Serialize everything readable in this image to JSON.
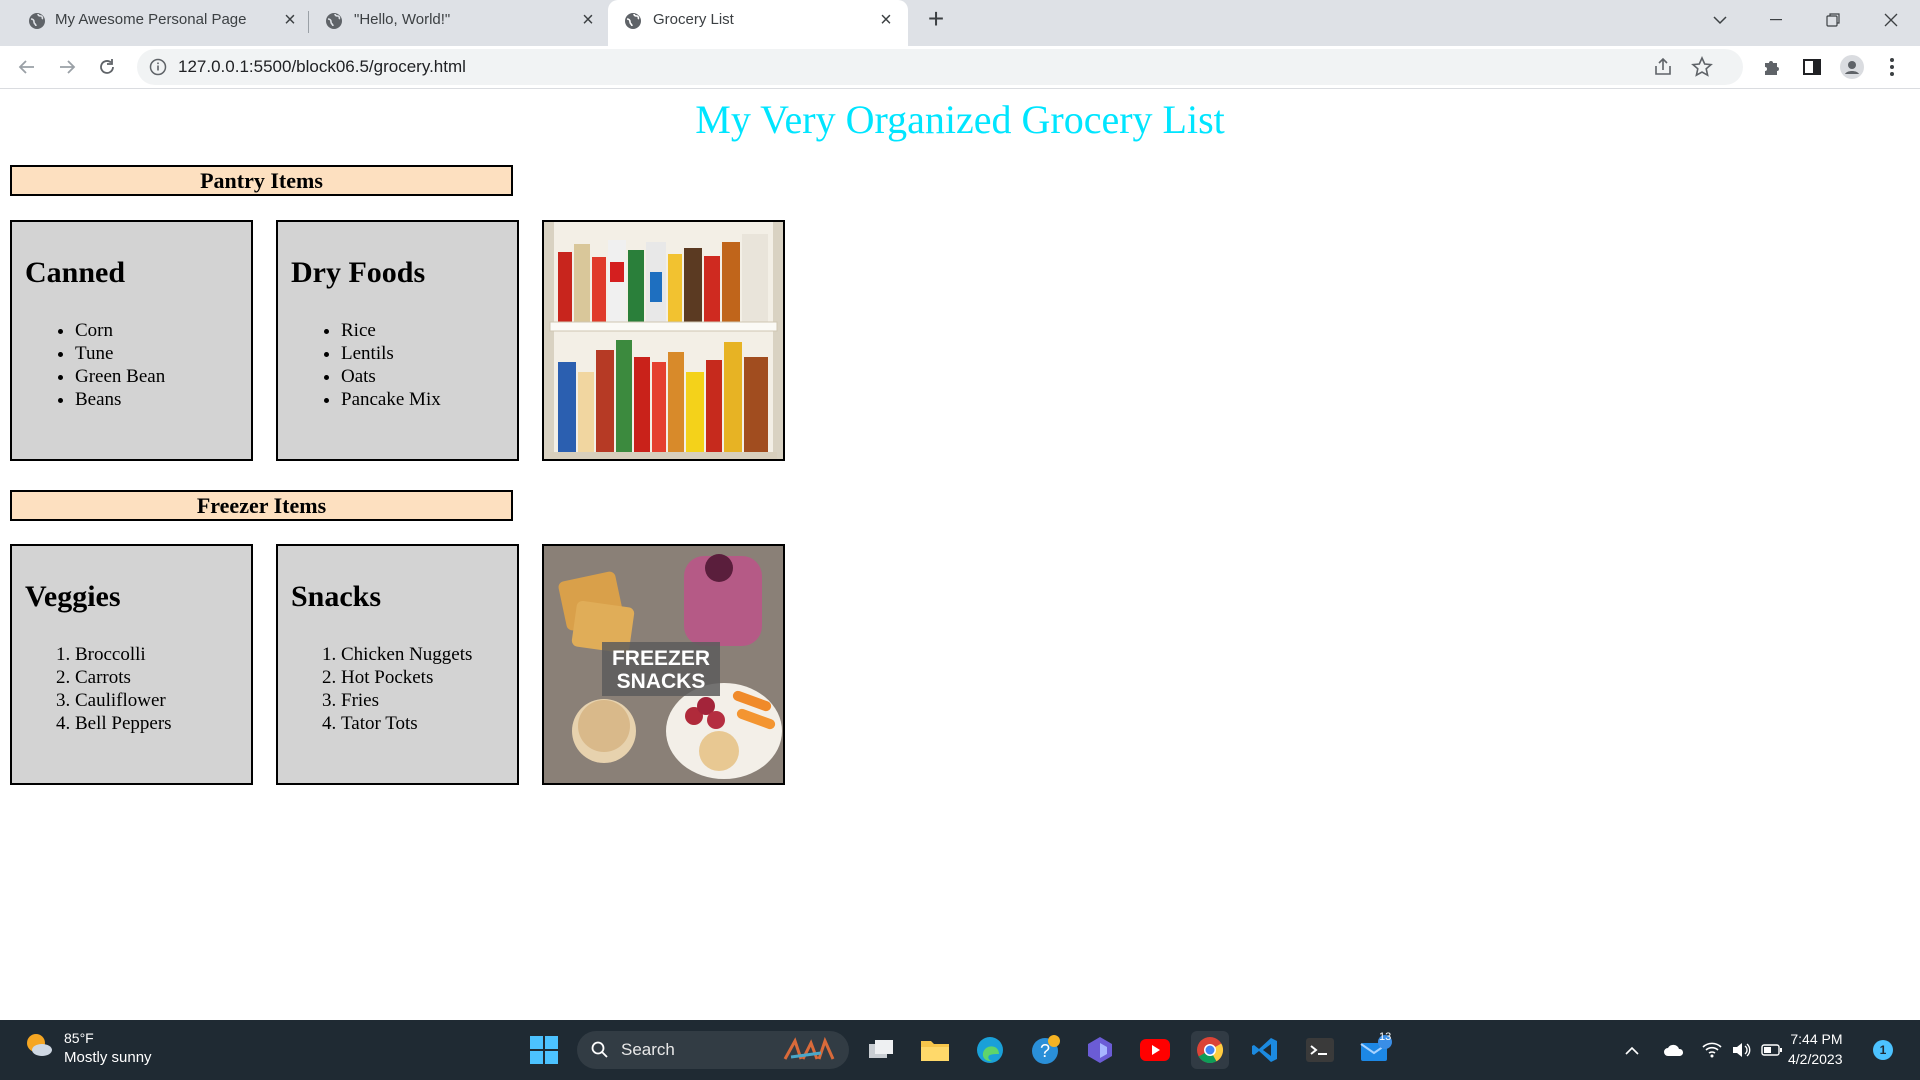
{
  "tabs": [
    {
      "title": "My Awesome Personal Page"
    },
    {
      "title": "\"Hello, World!\""
    },
    {
      "title": "Grocery List"
    }
  ],
  "address": {
    "url": "127.0.0.1:5500/block06.5/grocery.html"
  },
  "page": {
    "title": "My Very Organized Grocery List",
    "pantry": {
      "heading": "Pantry Items",
      "canned": {
        "title": "Canned",
        "items": [
          "Corn",
          "Tune",
          "Green Bean",
          "Beans"
        ]
      },
      "dry": {
        "title": "Dry Foods",
        "items": [
          "Rice",
          "Lentils",
          "Oats",
          "Pancake Mix"
        ]
      }
    },
    "freezer": {
      "heading": "Freezer Items",
      "veggies": {
        "title": "Veggies",
        "items": [
          "Broccolli",
          "Carrots",
          "Cauliflower",
          "Bell Peppers"
        ]
      },
      "snacks": {
        "title": "Snacks",
        "items": [
          "Chicken Nuggets",
          "Hot Pockets",
          "Fries",
          "Tator Tots"
        ]
      },
      "image_text": [
        "FREEZER",
        "SNACKS"
      ]
    }
  },
  "taskbar": {
    "weather": {
      "temp": "85°F",
      "condition": "Mostly sunny"
    },
    "search_label": "Search",
    "mail_badge": "13",
    "notification_badge": "1",
    "time": "7:44 PM",
    "date": "4/2/2023"
  },
  "colors": {
    "title": "#00e5ff",
    "section_bg": "#fde0c0",
    "card_bg": "#d3d3d3"
  }
}
